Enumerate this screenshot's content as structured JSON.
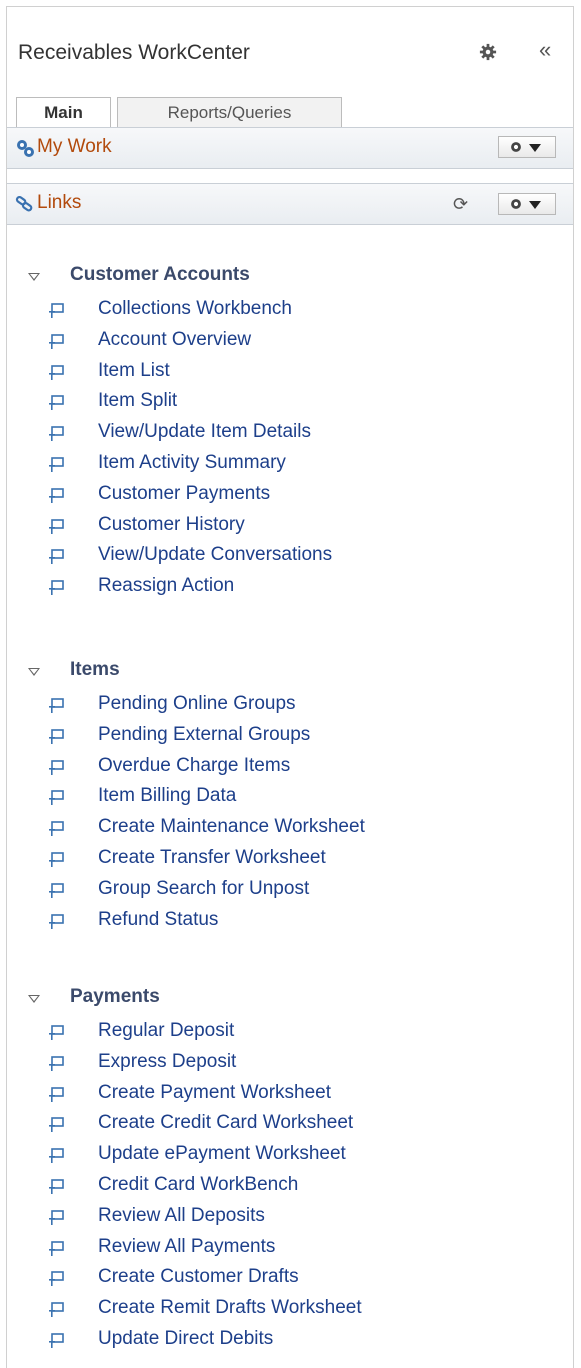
{
  "header": {
    "title": "Receivables WorkCenter",
    "gear_icon": "gear-icon",
    "collapse_label": "«"
  },
  "tabs": [
    {
      "label": "Main",
      "active": true
    },
    {
      "label": "Reports/Queries",
      "active": false
    }
  ],
  "my_work": {
    "label": "My Work",
    "icon": "gears-icon"
  },
  "links": {
    "label": "Links",
    "icon": "links-icon",
    "refresh_icon": "refresh-icon"
  },
  "groups": [
    {
      "title": "Customer Accounts",
      "items": [
        "Collections Workbench",
        "Account Overview",
        "Item List",
        "Item Split",
        "View/Update Item Details",
        "Item Activity Summary",
        "Customer Payments",
        "Customer History",
        "View/Update Conversations",
        "Reassign Action"
      ]
    },
    {
      "title": "Items",
      "items": [
        "Pending Online Groups",
        "Pending External Groups",
        "Overdue Charge Items",
        "Item Billing Data",
        "Create Maintenance Worksheet",
        "Create Transfer Worksheet",
        "Group Search for Unpost",
        "Refund Status"
      ]
    },
    {
      "title": "Payments",
      "items": [
        "Regular Deposit",
        "Express Deposit",
        "Create Payment Worksheet",
        "Create Credit Card Worksheet",
        "Update ePayment Worksheet",
        "Credit Card WorkBench",
        "Review All Deposits",
        "Review All Payments",
        "Create Customer Drafts",
        "Create Remit Drafts Worksheet",
        "Update Direct Debits"
      ]
    }
  ],
  "colors": {
    "link": "#1d3f8a",
    "section_label": "#b24a0c",
    "group_title": "#3b4a6b"
  }
}
